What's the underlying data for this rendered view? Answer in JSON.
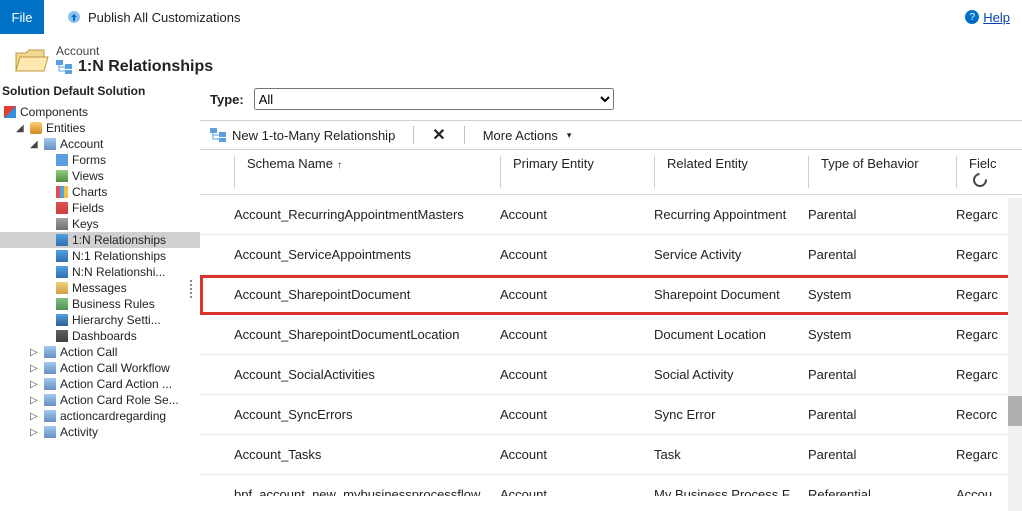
{
  "topbar": {
    "file": "File",
    "publish": "Publish All Customizations",
    "help": "Help"
  },
  "header": {
    "entity": "Account",
    "title": "1:N Relationships"
  },
  "leftPane": {
    "heading": "Solution Default Solution",
    "components": "Components",
    "entities": "Entities",
    "account": "Account",
    "forms": "Forms",
    "views": "Views",
    "charts": "Charts",
    "fields": "Fields",
    "keys": "Keys",
    "rel1n": "1:N Relationships",
    "reln1": "N:1 Relationships",
    "relnn": "N:N Relationshi...",
    "messages": "Messages",
    "bizrules": "Business Rules",
    "hierarchy": "Hierarchy Setti...",
    "dashboards": "Dashboards",
    "actionCall": "Action Call",
    "actionCallWorkflow": "Action Call Workflow",
    "actionCardAction": "Action Card Action ...",
    "actionCardRole": "Action Card Role Se...",
    "actioncardregarding": "actioncardregarding",
    "activity": "Activity"
  },
  "typeRow": {
    "label": "Type:",
    "selected": "All"
  },
  "toolbar": {
    "newRel": "New 1-to-Many Relationship",
    "moreActions": "More Actions"
  },
  "columns": {
    "schema": "Schema Name",
    "primary": "Primary Entity",
    "related": "Related Entity",
    "behavior": "Type of Behavior",
    "field": "Fielc"
  },
  "rows": [
    {
      "schema": "Account_RecurringAppointmentMasters",
      "primary": "Account",
      "related": "Recurring Appointment",
      "behavior": "Parental",
      "field": "Regarc",
      "highlight": false
    },
    {
      "schema": "Account_ServiceAppointments",
      "primary": "Account",
      "related": "Service Activity",
      "behavior": "Parental",
      "field": "Regarc",
      "highlight": false
    },
    {
      "schema": "Account_SharepointDocument",
      "primary": "Account",
      "related": "Sharepoint Document",
      "behavior": "System",
      "field": "Regarc",
      "highlight": true
    },
    {
      "schema": "Account_SharepointDocumentLocation",
      "primary": "Account",
      "related": "Document Location",
      "behavior": "System",
      "field": "Regarc",
      "highlight": false
    },
    {
      "schema": "Account_SocialActivities",
      "primary": "Account",
      "related": "Social Activity",
      "behavior": "Parental",
      "field": "Regarc",
      "highlight": false
    },
    {
      "schema": "Account_SyncErrors",
      "primary": "Account",
      "related": "Sync Error",
      "behavior": "Parental",
      "field": "Recorc",
      "highlight": false
    },
    {
      "schema": "Account_Tasks",
      "primary": "Account",
      "related": "Task",
      "behavior": "Parental",
      "field": "Regarc",
      "highlight": false
    },
    {
      "schema": "bpf_account_new_mybusinessprocessflow",
      "primary": "Account",
      "related": "My Business Process F...",
      "behavior": "Referential",
      "field": "Accou",
      "highlight": false
    }
  ]
}
